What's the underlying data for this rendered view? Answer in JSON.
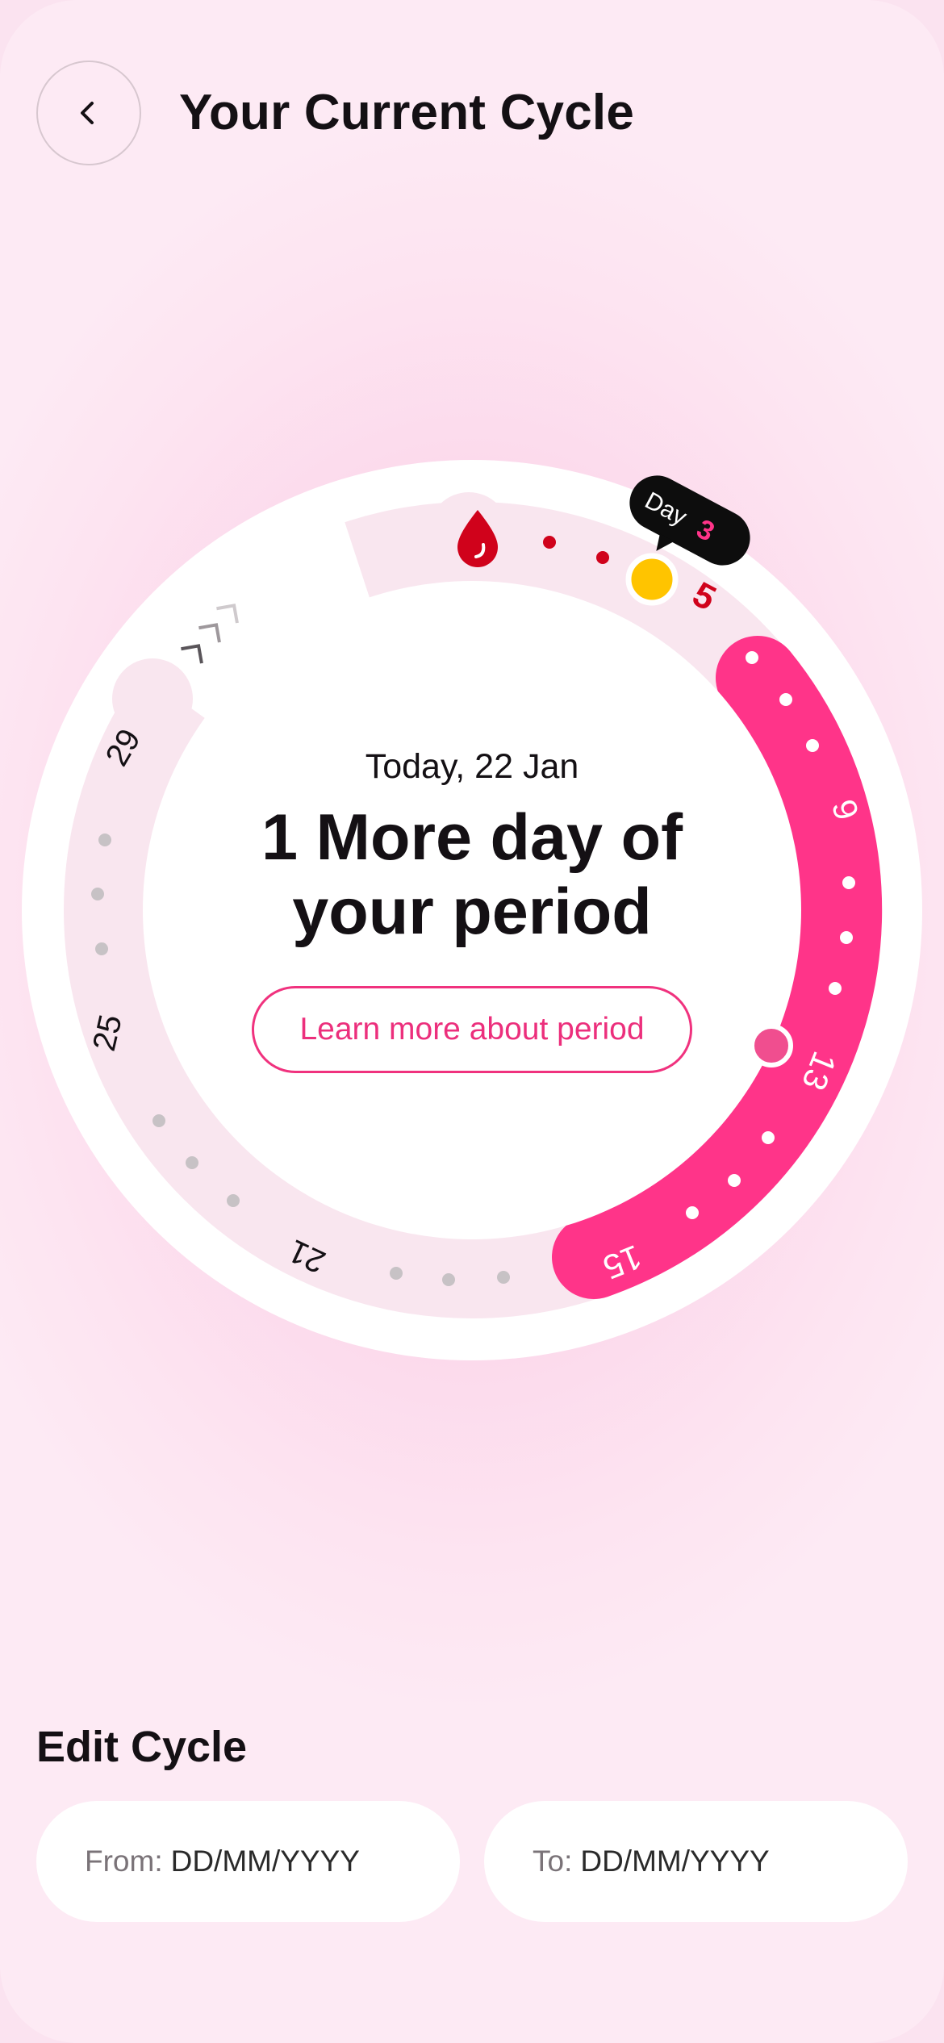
{
  "header": {
    "title": "Your Current Cycle",
    "back_icon": "chevron-left-icon"
  },
  "cycle": {
    "today_label": "Today, 22 Jan",
    "headline_line1": "1 More day of",
    "headline_line2": "your period",
    "learn_more_label": "Learn more about period",
    "tooltip_prefix": "Day",
    "tooltip_day": "3",
    "total_days": 30,
    "current_day": 3,
    "period_days": [
      1,
      5
    ],
    "fertile_window_days": [
      7,
      15
    ],
    "marker_day": 13,
    "day_labels": [
      "5",
      "9",
      "13",
      "15",
      "21",
      "25",
      "29"
    ],
    "icons": [
      "blood-drop-icon",
      "chevron-up-icon"
    ],
    "colors": {
      "accent": "#ff3489",
      "period": "#d0021b",
      "current_marker": "#ffc400",
      "inactive_dot": "#c7c2c5",
      "track": "#f9e6ef"
    }
  },
  "edit_cycle": {
    "title": "Edit Cycle",
    "from_label": "From:",
    "from_placeholder": "DD/MM/YYYY",
    "to_label": "To:",
    "to_placeholder": "DD/MM/YYYY"
  }
}
